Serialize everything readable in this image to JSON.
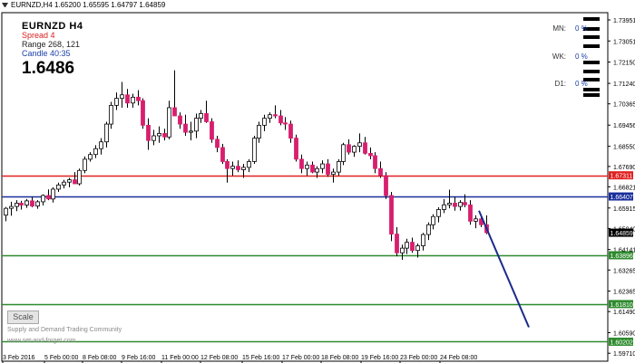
{
  "window": {
    "title": "EURNZD,H4  1.65200 1.65595 1.64797 1.64859"
  },
  "info": {
    "symbol": "EURNZD   H4",
    "spread_label": "Spread   4",
    "range_label": "Range   268, 121",
    "candle_label": "Candle   40:35",
    "bid": "1.6486"
  },
  "timeframes": [
    {
      "label": "MN:",
      "value": "0 %"
    },
    {
      "label": "WK:",
      "value": "0 %"
    },
    {
      "label": "D1:",
      "value": "0 %"
    }
  ],
  "scale_button": "Scale",
  "watermark": {
    "line1": "Supply and Demand Trading Community",
    "line2": "www.set-and-forget.com"
  },
  "colors": {
    "bull": "#ffffff",
    "bear": "#d81e6e",
    "resistance": "#e02020",
    "pivot": "#1a2f9c",
    "support": "#2e8b2e",
    "trend": "#1a2a8c"
  },
  "chart_data": {
    "type": "candlestick",
    "y_range": [
      1.5937,
      1.7426
    ],
    "y_ticks": [
      "1.73951",
      "1.73051",
      "1.72150",
      "1.71240",
      "1.70365",
      "1.69456",
      "1.68550",
      "1.67690",
      "1.66821",
      "1.65915",
      "1.65040",
      "1.64141",
      "1.63265",
      "1.62365",
      "1.61490",
      "1.60590",
      "1.59710"
    ],
    "x_labels": [
      "3 Feb 2016",
      "5 Feb 00:00",
      "8 Feb 08:00",
      "9 Feb 16:00",
      "11 Feb 00:00",
      "12 Feb 08:00",
      "15 Feb 16:00",
      "17 Feb 00:00",
      "18 Feb 08:00",
      "19 Feb 16:00",
      "23 Feb 00:00",
      "24 Feb 08:00"
    ],
    "levels": [
      {
        "label": "1.67311",
        "value": 1.67311,
        "kind": "resistance"
      },
      {
        "label": "1.66407",
        "value": 1.66407,
        "kind": "pivot"
      },
      {
        "label": "1.64859",
        "value": 1.64859,
        "kind": "current"
      },
      {
        "label": "1.63896",
        "value": 1.63896,
        "kind": "support"
      },
      {
        "label": "1.61810",
        "value": 1.6181,
        "kind": "support"
      },
      {
        "label": "1.60202",
        "value": 1.60202,
        "kind": "support"
      }
    ],
    "trendline": {
      "start": [
        "24 Feb 00:00",
        1.658
      ],
      "end": [
        "25 Feb 16:00",
        1.6082
      ]
    },
    "candles": [
      [
        1.6561,
        1.6596,
        1.6535,
        1.659
      ],
      [
        1.659,
        1.6618,
        1.6558,
        1.6598
      ],
      [
        1.6598,
        1.6625,
        1.6578,
        1.6612
      ],
      [
        1.6612,
        1.6622,
        1.6585,
        1.6604
      ],
      [
        1.6604,
        1.663,
        1.6592,
        1.6622
      ],
      [
        1.6622,
        1.664,
        1.6595,
        1.66
      ],
      [
        1.66,
        1.6625,
        1.6588,
        1.6618
      ],
      [
        1.6618,
        1.665,
        1.6602,
        1.6645
      ],
      [
        1.6645,
        1.6671,
        1.6625,
        1.663
      ],
      [
        1.663,
        1.668,
        1.6615,
        1.6672
      ],
      [
        1.6672,
        1.67,
        1.666,
        1.669
      ],
      [
        1.669,
        1.6712,
        1.6675,
        1.6702
      ],
      [
        1.6702,
        1.672,
        1.668,
        1.6712
      ],
      [
        1.6712,
        1.6745,
        1.67,
        1.6695
      ],
      [
        1.6695,
        1.676,
        1.6688,
        1.6752
      ],
      [
        1.6752,
        1.6812,
        1.674,
        1.68
      ],
      [
        1.68,
        1.683,
        1.679,
        1.682
      ],
      [
        1.682,
        1.686,
        1.6805,
        1.6845
      ],
      [
        1.6845,
        1.689,
        1.682,
        1.6874
      ],
      [
        1.6874,
        1.696,
        1.685,
        1.695
      ],
      [
        1.695,
        1.7045,
        1.693,
        1.703
      ],
      [
        1.703,
        1.7085,
        1.701,
        1.706
      ],
      [
        1.706,
        1.713,
        1.702,
        1.7075
      ],
      [
        1.7075,
        1.71,
        1.702,
        1.704
      ],
      [
        1.704,
        1.708,
        1.702,
        1.7065
      ],
      [
        1.7065,
        1.7095,
        1.703,
        1.705
      ],
      [
        1.705,
        1.706,
        1.693,
        1.6945
      ],
      [
        1.6945,
        1.6975,
        1.684,
        1.688
      ],
      [
        1.688,
        1.6925,
        1.686,
        1.69
      ],
      [
        1.69,
        1.694,
        1.687,
        1.691
      ],
      [
        1.691,
        1.693,
        1.688,
        1.6895
      ],
      [
        1.6895,
        1.705,
        1.6885,
        1.702
      ],
      [
        1.702,
        1.718,
        1.7,
        1.6985
      ],
      [
        1.6985,
        1.7,
        1.693,
        1.695
      ],
      [
        1.695,
        1.699,
        1.69,
        1.6915
      ],
      [
        1.6915,
        1.696,
        1.688,
        1.692
      ],
      [
        1.692,
        1.6995,
        1.689,
        1.6975
      ],
      [
        1.6975,
        1.701,
        1.6955,
        1.6995
      ],
      [
        1.6995,
        1.705,
        1.6955,
        1.696
      ],
      [
        1.696,
        1.6975,
        1.687,
        1.6885
      ],
      [
        1.6885,
        1.69,
        1.683,
        1.685
      ],
      [
        1.685,
        1.6865,
        1.678,
        1.679
      ],
      [
        1.679,
        1.68,
        1.67,
        1.676
      ],
      [
        1.676,
        1.679,
        1.673,
        1.677
      ],
      [
        1.677,
        1.6795,
        1.6745,
        1.6755
      ],
      [
        1.6755,
        1.678,
        1.672,
        1.6765
      ],
      [
        1.6765,
        1.68,
        1.6745,
        1.679
      ],
      [
        1.679,
        1.69,
        1.678,
        1.689
      ],
      [
        1.689,
        1.696,
        1.687,
        1.6945
      ],
      [
        1.6945,
        1.699,
        1.692,
        1.6975
      ],
      [
        1.6975,
        1.7,
        1.6955,
        1.699
      ],
      [
        1.699,
        1.703,
        1.6975,
        1.6985
      ],
      [
        1.6985,
        1.701,
        1.6945,
        1.6955
      ],
      [
        1.6955,
        1.698,
        1.6925,
        1.695
      ],
      [
        1.695,
        1.6965,
        1.687,
        1.689
      ],
      [
        1.689,
        1.6905,
        1.679,
        1.68
      ],
      [
        1.68,
        1.682,
        1.674,
        1.676
      ],
      [
        1.676,
        1.679,
        1.673,
        1.6775
      ],
      [
        1.6775,
        1.679,
        1.674,
        1.6745
      ],
      [
        1.6745,
        1.677,
        1.672,
        1.676
      ],
      [
        1.676,
        1.6795,
        1.674,
        1.678
      ],
      [
        1.678,
        1.68,
        1.6725,
        1.6735
      ],
      [
        1.6735,
        1.676,
        1.67,
        1.6745
      ],
      [
        1.6745,
        1.68,
        1.673,
        1.679
      ],
      [
        1.679,
        1.687,
        1.6775,
        1.6862
      ],
      [
        1.6862,
        1.6885,
        1.682,
        1.683
      ],
      [
        1.683,
        1.686,
        1.681,
        1.6855
      ],
      [
        1.6855,
        1.691,
        1.683,
        1.687
      ],
      [
        1.687,
        1.6895,
        1.682,
        1.6825
      ],
      [
        1.6825,
        1.685,
        1.68,
        1.6815
      ],
      [
        1.6815,
        1.683,
        1.674,
        1.676
      ],
      [
        1.676,
        1.679,
        1.672,
        1.673
      ],
      [
        1.673,
        1.6745,
        1.663,
        1.6645
      ],
      [
        1.6645,
        1.666,
        1.645,
        1.648
      ],
      [
        1.648,
        1.651,
        1.6385,
        1.64
      ],
      [
        1.64,
        1.6435,
        1.637,
        1.642
      ],
      [
        1.642,
        1.646,
        1.6395,
        1.6445
      ],
      [
        1.6445,
        1.6465,
        1.64,
        1.641
      ],
      [
        1.641,
        1.644,
        1.638,
        1.643
      ],
      [
        1.643,
        1.6485,
        1.641,
        1.6478
      ],
      [
        1.6478,
        1.653,
        1.6455,
        1.652
      ],
      [
        1.652,
        1.6565,
        1.65,
        1.6555
      ],
      [
        1.6555,
        1.6595,
        1.653,
        1.6585
      ],
      [
        1.6585,
        1.663,
        1.657,
        1.6605
      ],
      [
        1.6605,
        1.667,
        1.659,
        1.6612
      ],
      [
        1.6612,
        1.664,
        1.658,
        1.6598
      ],
      [
        1.6598,
        1.6625,
        1.658,
        1.6615
      ],
      [
        1.6615,
        1.665,
        1.6595,
        1.6605
      ],
      [
        1.6605,
        1.6625,
        1.652,
        1.6535
      ],
      [
        1.6535,
        1.656,
        1.6505,
        1.6545
      ],
      [
        1.6545,
        1.656,
        1.651,
        1.652
      ],
      [
        1.652,
        1.656,
        1.648,
        1.6486
      ]
    ]
  }
}
